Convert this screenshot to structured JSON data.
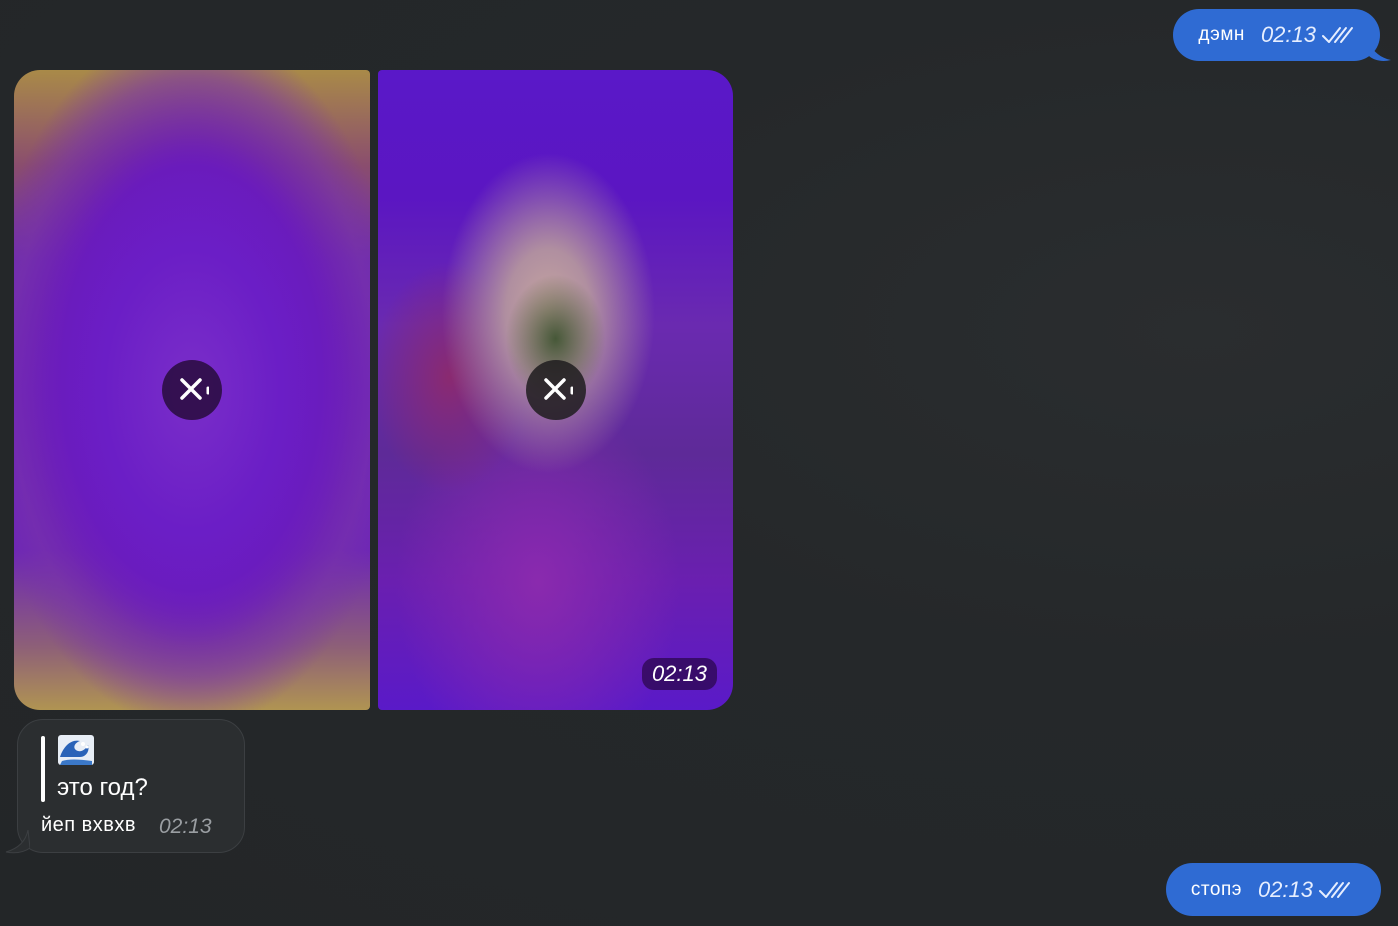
{
  "messages": {
    "outgoing_1": {
      "text": "дэмн",
      "time": "02:13",
      "status_icon": "double-check-icon"
    },
    "album": {
      "photo_1": {
        "action_icon": "close-icon"
      },
      "photo_2": {
        "action_icon": "close-icon",
        "time": "02:13"
      }
    },
    "incoming": {
      "reply_emoji": "🌊",
      "reply_text": "это год?",
      "text": "йеп вхвхв",
      "time": "02:13"
    },
    "outgoing_2": {
      "text": "стопэ",
      "time": "02:13",
      "status_icon": "double-check-icon"
    }
  },
  "colors": {
    "background": "#25282a",
    "outgoing_bubble": "#2f6bd3",
    "incoming_bubble": "#2b2e30"
  }
}
